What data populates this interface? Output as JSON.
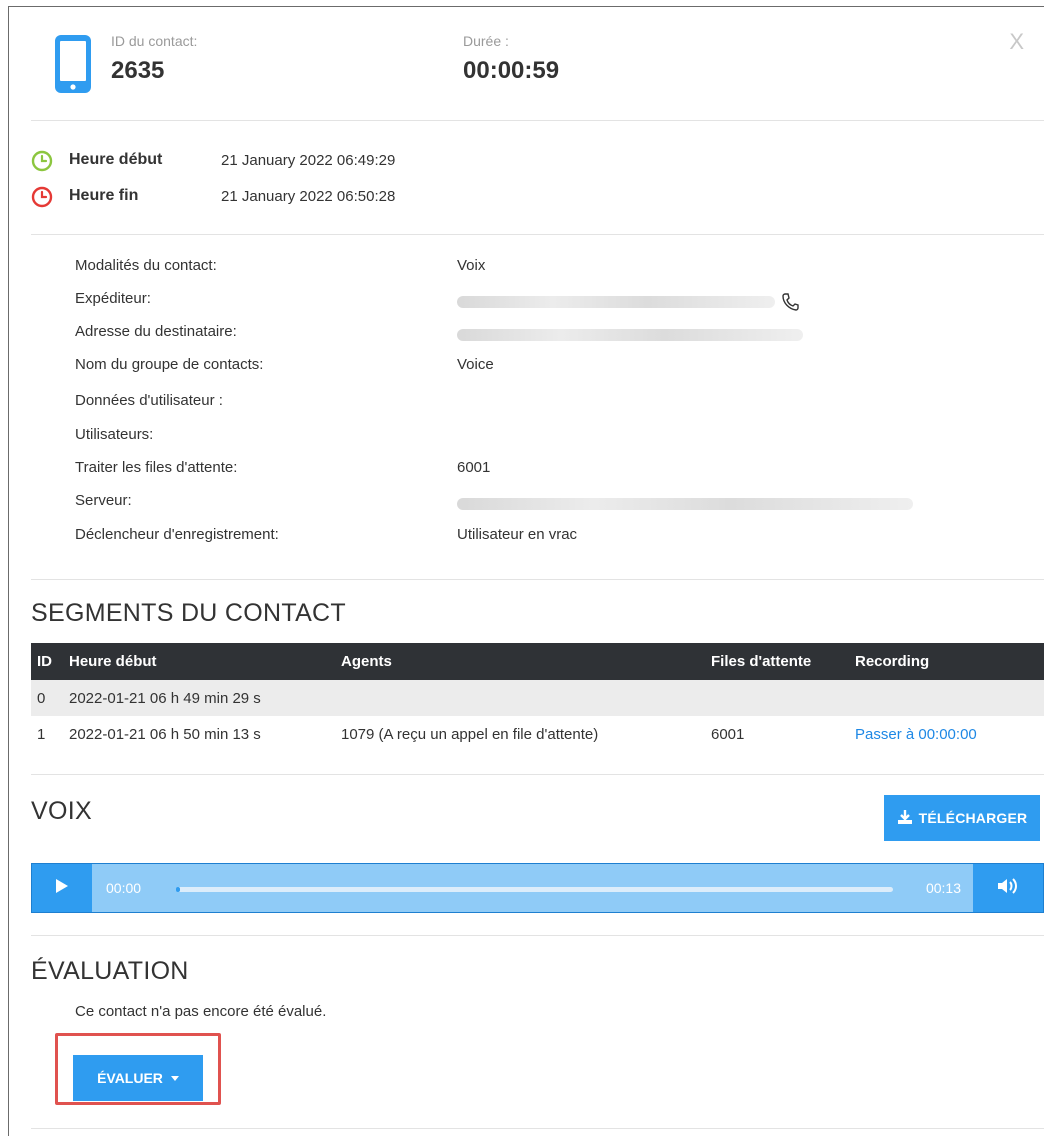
{
  "header": {
    "contact_id_label": "ID du contact:",
    "contact_id_value": "2635",
    "duration_label": "Durée :",
    "duration_value": "00:00:59",
    "close_label": "X",
    "icon": "mobile-phone-icon"
  },
  "times": {
    "start_label": "Heure début",
    "start_value": "21 January 2022 06:49:29",
    "end_label": "Heure fin",
    "end_value": "21 January 2022 06:50:28",
    "start_color": "#8cc63f",
    "end_color": "#e53935"
  },
  "info": {
    "modalites_label": "Modalités du contact:",
    "modalites_value": "Voix",
    "expediteur_label": "Expéditeur:",
    "destinataire_label": "Adresse du destinataire:",
    "groupe_label": "Nom du groupe de contacts:",
    "groupe_value": "Voice",
    "donnees_label": "Données d'utilisateur :",
    "utilisateurs_label": "Utilisateurs:",
    "files_label": "Traiter les files d'attente:",
    "files_value": "6001",
    "serveur_label": "Serveur:",
    "declencheur_label": "Déclencheur d'enregistrement:",
    "declencheur_value": "Utilisateur en vrac"
  },
  "segments": {
    "title": "SEGMENTS DU CONTACT",
    "headers": {
      "id": "ID",
      "start": "Heure début",
      "agents": "Agents",
      "queues": "Files d'attente",
      "recording": "Recording"
    },
    "rows": [
      {
        "id": "0",
        "start": "2022-01-21 06 h 49 min 29 s",
        "agents": "",
        "queues": "",
        "recording": ""
      },
      {
        "id": "1",
        "start": "2022-01-21 06 h 50 min 13 s",
        "agents": "1079 (A reçu un appel en file d'attente)",
        "queues": "6001",
        "recording": "Passer à 00:00:00"
      }
    ]
  },
  "voice": {
    "title": "VOIX",
    "download_label": "TÉLÉCHARGER",
    "current_time": "00:00",
    "total_time": "00:13",
    "progress": 0.0,
    "accent": "#2f9cf0"
  },
  "evaluation": {
    "title": "ÉVALUATION",
    "note": "Ce contact n'a pas encore été évalué.",
    "button_label": "ÉVALUER",
    "highlight_color": "#e0524f"
  }
}
